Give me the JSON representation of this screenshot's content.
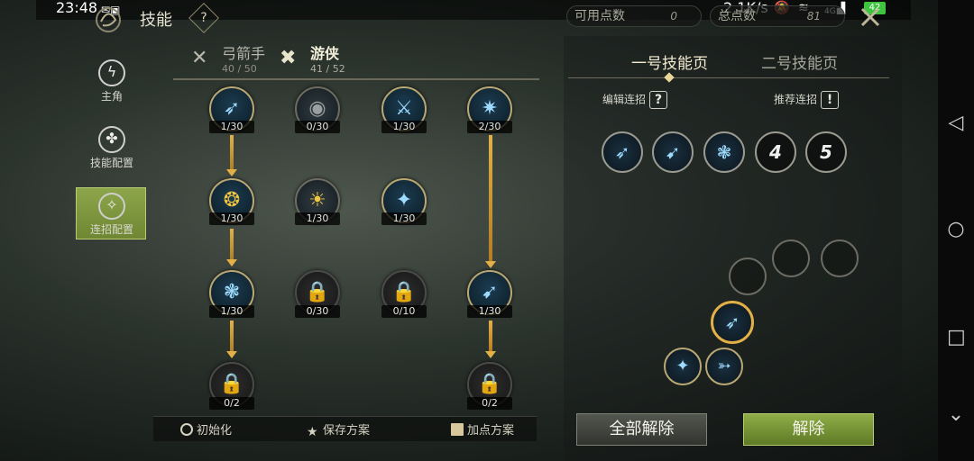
{
  "status": {
    "time": "23:48",
    "network": "2.1K/s",
    "battery": "42",
    "signal": "4G"
  },
  "header": {
    "title": "技能",
    "help": "?"
  },
  "points": {
    "available_label": "可用点数",
    "available_value": "0",
    "total_label": "总点数",
    "total_value": "81"
  },
  "sidebar": [
    {
      "label": "主角"
    },
    {
      "label": "技能配置"
    },
    {
      "label": "连招配置"
    }
  ],
  "classes": [
    {
      "name": "弓箭手",
      "points": "40 / 50"
    },
    {
      "name": "游侠",
      "points": "41 / 52"
    }
  ],
  "skills": [
    {
      "level": "1/30",
      "icon": "archer-shot-icon"
    },
    {
      "level": "0/30",
      "icon": "eye-icon"
    },
    {
      "level": "1/30",
      "icon": "strike-icon"
    },
    {
      "level": "2/30",
      "icon": "burst-icon"
    },
    {
      "level": "1/30",
      "icon": "shield-icon"
    },
    {
      "level": "1/30",
      "icon": "sun-eye-icon"
    },
    {
      "level": "1/30",
      "icon": "kick-icon"
    },
    {
      "level": "1/30",
      "icon": "whirlwind-icon"
    },
    {
      "level": "0/30",
      "icon": "lock-icon"
    },
    {
      "level": "0/10",
      "icon": "lock-icon"
    },
    {
      "level": "1/30",
      "icon": "dash-icon"
    },
    {
      "level": "0/2",
      "icon": "lock-icon"
    },
    {
      "level": "0/2",
      "icon": "lock-icon"
    }
  ],
  "toolbar": {
    "reset": "初始化",
    "save": "保存方案",
    "plan": "加点方案"
  },
  "pages": {
    "page1": "一号技能页",
    "page2": "二号技能页"
  },
  "combo": {
    "edit_label": "编辑连招",
    "recommend_label": "推荐连招",
    "edit_icon": "?",
    "recommend_icon": "!",
    "slot4": "4",
    "slot5": "5"
  },
  "actions": {
    "clear_all": "全部解除",
    "remove": "解除"
  },
  "colors": {
    "accent_green": "#7a9438",
    "gold": "#e3b048",
    "skill_blue": "#9edcff"
  }
}
